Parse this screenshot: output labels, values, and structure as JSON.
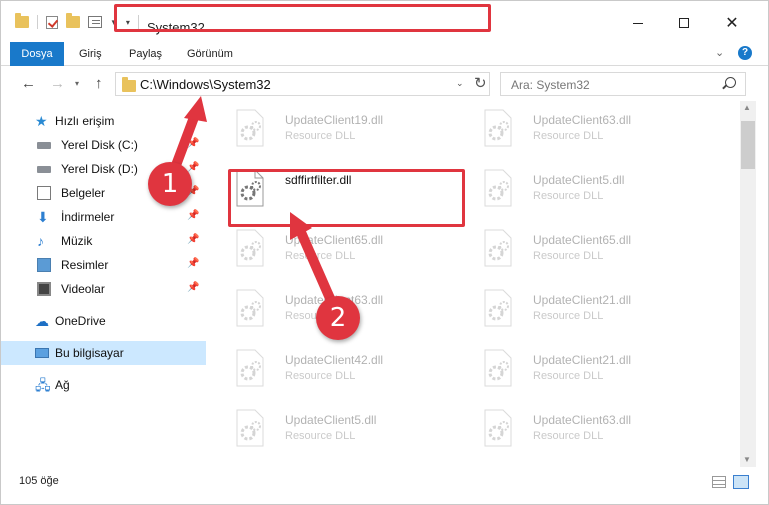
{
  "window": {
    "title": "System32"
  },
  "ribbon": {
    "tabs": [
      "Dosya",
      "Giriş",
      "Paylaş",
      "Görünüm"
    ],
    "help": "?"
  },
  "nav": {
    "address": "C:\\Windows\\System32",
    "search_placeholder": "Ara: System32"
  },
  "sidebar": {
    "quick_access": "Hızlı erişim",
    "items": [
      {
        "label": "Yerel Disk (C:)",
        "icon": "drive-icon"
      },
      {
        "label": "Yerel Disk (D:)",
        "icon": "drive-icon"
      },
      {
        "label": "Belgeler",
        "icon": "documents-icon"
      },
      {
        "label": "İndirmeler",
        "icon": "downloads-icon"
      },
      {
        "label": "Müzik",
        "icon": "music-icon"
      },
      {
        "label": "Resimler",
        "icon": "pictures-icon"
      },
      {
        "label": "Videolar",
        "icon": "videos-icon"
      }
    ],
    "onedrive": "OneDrive",
    "this_pc": "Bu bilgisayar",
    "network": "Ağ"
  },
  "files": {
    "left": [
      {
        "name": "UpdateClient19.dll",
        "type": "Resource DLL"
      },
      {
        "name": "sdffirtfilter.dll",
        "type": ""
      },
      {
        "name": "UpdateClient65.dll",
        "type": "Resource DLL"
      },
      {
        "name": "UpdateClient63.dll",
        "type": "Resource DLL"
      },
      {
        "name": "UpdateClient42.dll",
        "type": "Resource DLL"
      },
      {
        "name": "UpdateClient5.dll",
        "type": "Resource DLL"
      }
    ],
    "right": [
      {
        "name": "UpdateClient63.dll",
        "type": "Resource DLL"
      },
      {
        "name": "UpdateClient5.dll",
        "type": "Resource DLL"
      },
      {
        "name": "UpdateClient65.dll",
        "type": "Resource DLL"
      },
      {
        "name": "UpdateClient21.dll",
        "type": "Resource DLL"
      },
      {
        "name": "UpdateClient21.dll",
        "type": "Resource DLL"
      },
      {
        "name": "UpdateClient63.dll",
        "type": "Resource DLL"
      }
    ]
  },
  "status": {
    "count": "105 öğe"
  },
  "callouts": {
    "one": "1",
    "two": "2"
  },
  "colors": {
    "accent": "#1979ca",
    "highlight": "#e0353f",
    "selection": "#cce8ff"
  }
}
